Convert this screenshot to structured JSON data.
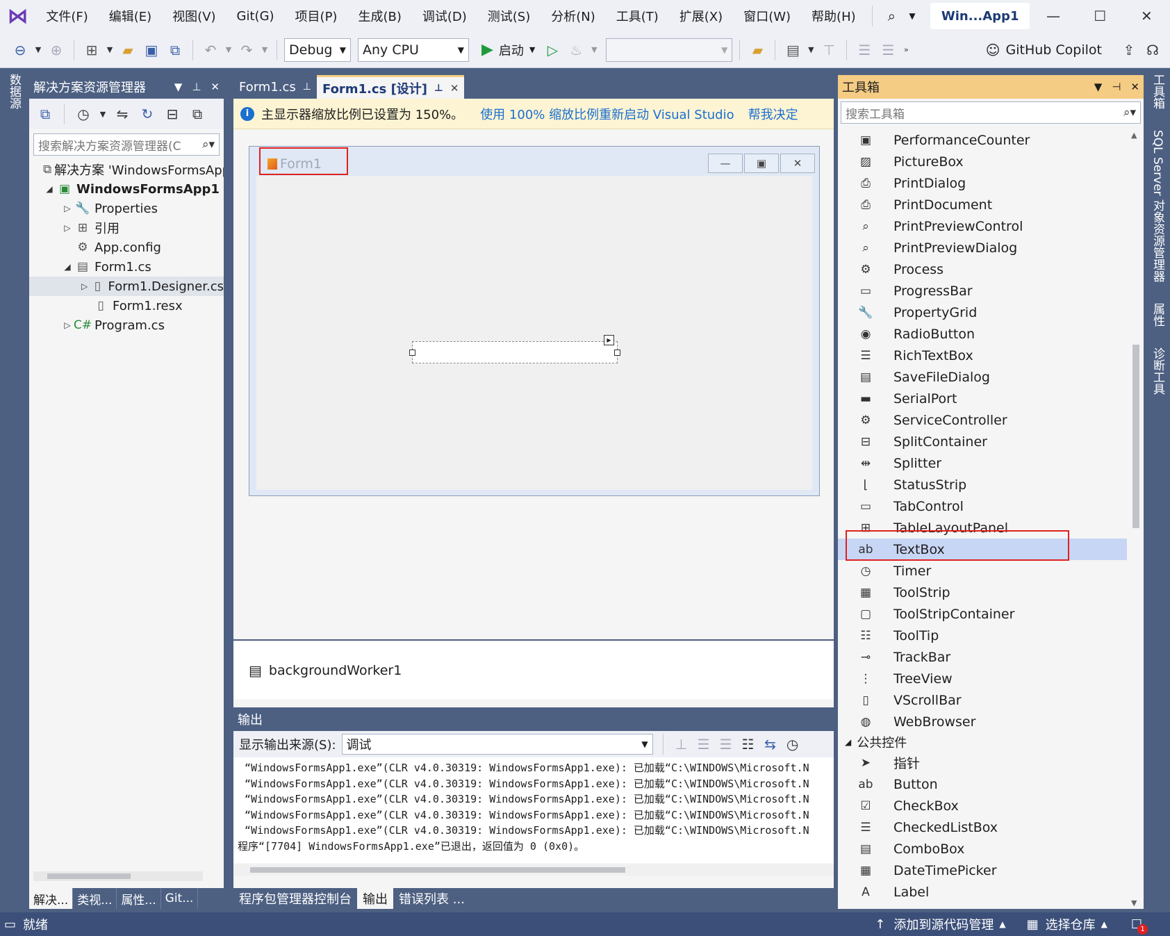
{
  "menu": {
    "items": [
      "文件(F)",
      "编辑(E)",
      "视图(V)",
      "Git(G)",
      "项目(P)",
      "生成(B)",
      "调试(D)",
      "测试(S)",
      "分析(N)",
      "工具(T)",
      "扩展(X)",
      "窗口(W)",
      "帮助(H)"
    ],
    "window_title": "Win...App1"
  },
  "toolbar": {
    "config": "Debug",
    "platform": "Any CPU",
    "start_label": "启动",
    "copilot_label": "GitHub Copilot"
  },
  "left_strip": {
    "tab1": "数据源"
  },
  "solution_explorer": {
    "title": "解决方案资源管理器",
    "search_placeholder": "搜索解决方案资源管理器(C",
    "tree": [
      {
        "label": "解决方案 'WindowsFormsApp1'",
        "icon": "solution-icon",
        "level": 0,
        "expander": ""
      },
      {
        "label": "WindowsFormsApp1",
        "icon": "csharp-project-icon",
        "level": 0,
        "expander": "◢",
        "bold": true
      },
      {
        "label": "Properties",
        "icon": "wrench-icon",
        "level": 1,
        "expander": "▷"
      },
      {
        "label": "引用",
        "icon": "references-icon",
        "level": 1,
        "expander": "▷"
      },
      {
        "label": "App.config",
        "icon": "config-icon",
        "level": 1,
        "expander": ""
      },
      {
        "label": "Form1.cs",
        "icon": "form-icon",
        "level": 1,
        "expander": "◢"
      },
      {
        "label": "Form1.Designer.cs",
        "icon": "file-icon",
        "level": 2,
        "expander": "▷",
        "selected": true
      },
      {
        "label": "Form1.resx",
        "icon": "file-icon",
        "level": 2,
        "expander": ""
      },
      {
        "label": "Program.cs",
        "icon": "csharp-file-icon",
        "level": 1,
        "expander": "▷"
      }
    ],
    "bottom_tabs": [
      "解决...",
      "类视...",
      "属性...",
      "Git..."
    ]
  },
  "document_tabs": [
    {
      "label": "Form1.cs",
      "active": false
    },
    {
      "label": "Form1.cs [设计]",
      "active": true
    }
  ],
  "infobar": {
    "message": "主显示器缩放比例已设置为 150%。",
    "link1": "使用 100% 缩放比例重新启动 Visual Studio",
    "link2": "帮我决定"
  },
  "designer": {
    "form_title": "Form1",
    "tray_component": "backgroundWorker1"
  },
  "output": {
    "title": "输出",
    "source_label": "显示输出来源(S):",
    "source_value": "调试",
    "lines": [
      "“WindowsFormsApp1.exe”(CLR v4.0.30319: WindowsFormsApp1.exe): 已加载“C:\\WINDOWS\\Microsoft.N",
      "“WindowsFormsApp1.exe”(CLR v4.0.30319: WindowsFormsApp1.exe): 已加载“C:\\WINDOWS\\Microsoft.N",
      "“WindowsFormsApp1.exe”(CLR v4.0.30319: WindowsFormsApp1.exe): 已加载“C:\\WINDOWS\\Microsoft.N",
      "“WindowsFormsApp1.exe”(CLR v4.0.30319: WindowsFormsApp1.exe): 已加载“C:\\WINDOWS\\Microsoft.N",
      "“WindowsFormsApp1.exe”(CLR v4.0.30319: WindowsFormsApp1.exe): 已加载“C:\\WINDOWS\\Microsoft.N",
      "程序“[7704] WindowsFormsApp1.exe”已退出，返回值为 0 (0x0)。"
    ],
    "tabs": [
      {
        "label": "程序包管理器控制台",
        "active": false
      },
      {
        "label": "输出",
        "active": true
      },
      {
        "label": "错误列表 ...",
        "active": false
      }
    ]
  },
  "toolbox": {
    "title": "工具箱",
    "search_placeholder": "搜索工具箱",
    "items": [
      {
        "label": "PerformanceCounter",
        "icon": "performance-counter-icon",
        "glyph": "▣"
      },
      {
        "label": "PictureBox",
        "icon": "picturebox-icon",
        "glyph": "▨"
      },
      {
        "label": "PrintDialog",
        "icon": "printer-icon",
        "glyph": "⎙"
      },
      {
        "label": "PrintDocument",
        "icon": "printer-icon",
        "glyph": "⎙"
      },
      {
        "label": "PrintPreviewControl",
        "icon": "print-preview-icon",
        "glyph": "⌕"
      },
      {
        "label": "PrintPreviewDialog",
        "icon": "print-preview-icon",
        "glyph": "⌕"
      },
      {
        "label": "Process",
        "icon": "gears-icon",
        "glyph": "⚙"
      },
      {
        "label": "ProgressBar",
        "icon": "progressbar-icon",
        "glyph": "▭"
      },
      {
        "label": "PropertyGrid",
        "icon": "wrench-icon",
        "glyph": "🔧"
      },
      {
        "label": "RadioButton",
        "icon": "radio-icon",
        "glyph": "◉"
      },
      {
        "label": "RichTextBox",
        "icon": "richtextbox-icon",
        "glyph": "☰"
      },
      {
        "label": "SaveFileDialog",
        "icon": "save-icon",
        "glyph": "▤"
      },
      {
        "label": "SerialPort",
        "icon": "serial-port-icon",
        "glyph": "▬"
      },
      {
        "label": "ServiceController",
        "icon": "service-icon",
        "glyph": "⚙"
      },
      {
        "label": "SplitContainer",
        "icon": "split-container-icon",
        "glyph": "⊟"
      },
      {
        "label": "Splitter",
        "icon": "splitter-icon",
        "glyph": "⇹"
      },
      {
        "label": "StatusStrip",
        "icon": "statusstrip-icon",
        "glyph": "⌊"
      },
      {
        "label": "TabControl",
        "icon": "tabcontrol-icon",
        "glyph": "▭"
      },
      {
        "label": "TableLayoutPanel",
        "icon": "tablelayout-icon",
        "glyph": "⊞"
      },
      {
        "label": "TextBox",
        "icon": "textbox-icon",
        "glyph": "ab",
        "selected": true
      },
      {
        "label": "Timer",
        "icon": "timer-icon",
        "glyph": "◷"
      },
      {
        "label": "ToolStrip",
        "icon": "toolstrip-icon",
        "glyph": "▦"
      },
      {
        "label": "ToolStripContainer",
        "icon": "toolstrip-container-icon",
        "glyph": "▢"
      },
      {
        "label": "ToolTip",
        "icon": "tooltip-icon",
        "glyph": "☷"
      },
      {
        "label": "TrackBar",
        "icon": "trackbar-icon",
        "glyph": "⊸"
      },
      {
        "label": "TreeView",
        "icon": "treeview-icon",
        "glyph": "⋮"
      },
      {
        "label": "VScrollBar",
        "icon": "vscrollbar-icon",
        "glyph": "▯"
      },
      {
        "label": "WebBrowser",
        "icon": "globe-icon",
        "glyph": "◍"
      }
    ],
    "group_label": "公共控件",
    "group_items": [
      {
        "label": "指针",
        "icon": "pointer-icon",
        "glyph": "➤"
      },
      {
        "label": "Button",
        "icon": "button-icon",
        "glyph": "ab"
      },
      {
        "label": "CheckBox",
        "icon": "checkbox-icon",
        "glyph": "☑"
      },
      {
        "label": "CheckedListBox",
        "icon": "checkedlist-icon",
        "glyph": "☰"
      },
      {
        "label": "ComboBox",
        "icon": "combobox-icon",
        "glyph": "▤"
      },
      {
        "label": "DateTimePicker",
        "icon": "datetime-icon",
        "glyph": "▦"
      },
      {
        "label": "Label",
        "icon": "label-icon",
        "glyph": "A"
      }
    ]
  },
  "right_strip": {
    "tabs": [
      "工具箱",
      "SQL Server 对象资源管理器",
      "属性",
      "诊断工具"
    ]
  },
  "statusbar": {
    "ready": "就绪",
    "add_source": "添加到源代码管理",
    "select_repo": "选择仓库",
    "notification_count": "1"
  }
}
